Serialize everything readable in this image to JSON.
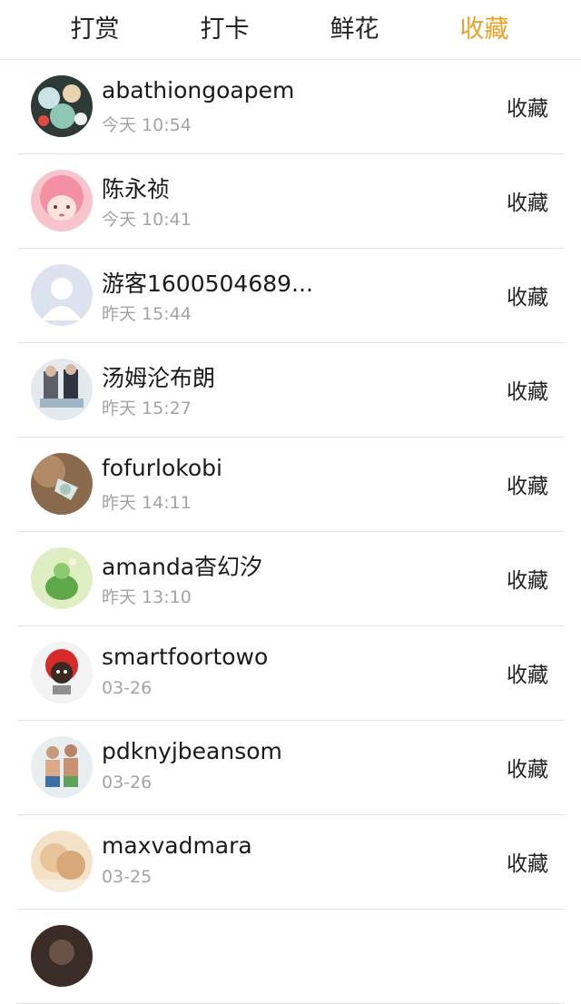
{
  "tabs": [
    {
      "label": "打赏",
      "active": false
    },
    {
      "label": "打卡",
      "active": false
    },
    {
      "label": "鲜花",
      "active": false
    },
    {
      "label": "收藏",
      "active": true
    }
  ],
  "accent_color": "#e9a227",
  "action_label": "收藏",
  "items": [
    {
      "name": "abathiongoapem",
      "time": "今天 10:54",
      "action": "收藏"
    },
    {
      "name": "陈永祯",
      "time": "今天 10:41",
      "action": "收藏"
    },
    {
      "name": "游客1600504689...",
      "time": "昨天 15:44",
      "action": "收藏"
    },
    {
      "name": "汤姆沦布朗",
      "time": "昨天 15:27",
      "action": "收藏"
    },
    {
      "name": "fofurlokobi",
      "time": "昨天 14:11",
      "action": "收藏"
    },
    {
      "name": "amanda杳幻汐",
      "time": "昨天 13:10",
      "action": "收藏"
    },
    {
      "name": "smartfoortowo",
      "time": "03-26",
      "action": "收藏"
    },
    {
      "name": "pdknyjbeansom",
      "time": "03-26",
      "action": "收藏"
    },
    {
      "name": "maxvadmara",
      "time": "03-25",
      "action": "收藏"
    }
  ]
}
